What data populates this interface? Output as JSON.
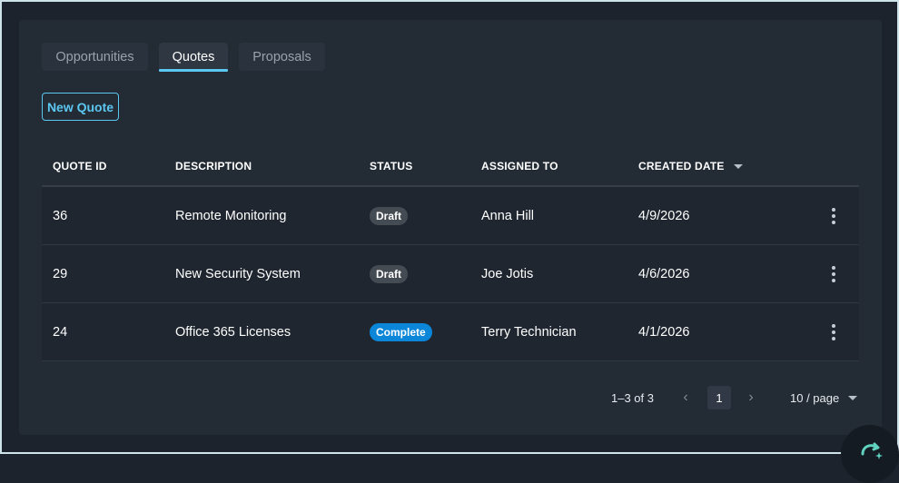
{
  "tabs": [
    {
      "label": "Opportunities",
      "active": false
    },
    {
      "label": "Quotes",
      "active": true
    },
    {
      "label": "Proposals",
      "active": false
    }
  ],
  "actions": {
    "new_quote_label": "New Quote"
  },
  "table": {
    "columns": [
      "QUOTE ID",
      "DESCRIPTION",
      "STATUS",
      "ASSIGNED TO",
      "CREATED DATE"
    ],
    "sort": {
      "column": "CREATED DATE",
      "direction": "descending"
    },
    "rows": [
      {
        "id": "36",
        "description": "Remote Monitoring",
        "status": "Draft",
        "assigned_to": "Anna Hill",
        "created": "4/9/2026"
      },
      {
        "id": "29",
        "description": "New Security System",
        "status": "Draft",
        "assigned_to": "Joe Jotis",
        "created": "4/6/2026"
      },
      {
        "id": "24",
        "description": "Office 365 Licenses",
        "status": "Complete",
        "assigned_to": "Terry Technician",
        "created": "4/1/2026"
      }
    ]
  },
  "pagination": {
    "range_text": "1–3 of 3",
    "current_page": "1",
    "page_size_label": "10 / page",
    "prev_icon": "‹",
    "next_icon": "›"
  },
  "colors": {
    "accent": "#5cc8f2",
    "badge_draft": "#454b52",
    "badge_complete": "#0b86d8"
  },
  "icons": {
    "row_menu": "kebab-icon",
    "sort": "caret-down-icon",
    "fab": "refresh-sparkle-icon"
  }
}
